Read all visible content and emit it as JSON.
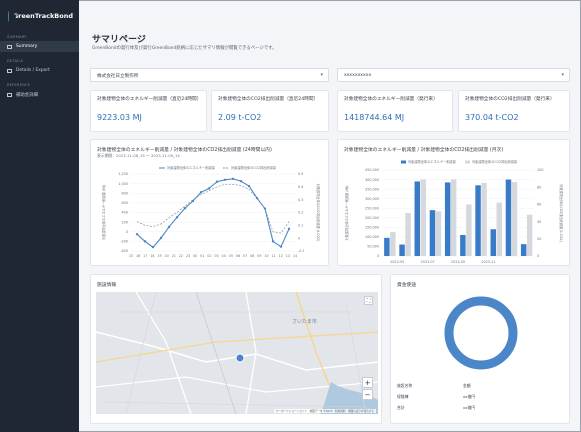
{
  "app": {
    "logo_text": "GreenTrackBond"
  },
  "sidebar": {
    "sections": [
      {
        "label": "SUMMARY",
        "items": [
          {
            "label": "Summary",
            "active": true
          }
        ]
      },
      {
        "label": "DETAILS",
        "items": [
          {
            "label": "Details / Export",
            "active": false
          }
        ]
      },
      {
        "label": "REFERENCE",
        "items": [
          {
            "label": "補助金詳細",
            "active": false
          }
        ]
      }
    ]
  },
  "page": {
    "title": "サマリページ",
    "description": "GreenBondの発行体及び発行GreenBond銘柄に応じたサマリ情報が閲覧できるページです。"
  },
  "filters": {
    "company": {
      "value": "株式会社日立製作所"
    },
    "bond": {
      "value": "xxxxxxxxxx"
    }
  },
  "kpis": [
    {
      "label": "対象建物全体のエネルギー削減量（直近24時間）",
      "value": "9223.03 MJ"
    },
    {
      "label": "対象建物全体のCO2排出削減量（直近24時間）",
      "value": "2.09 t-CO2"
    },
    {
      "label": "対象建物全体のエネルギー削減量（発行来）",
      "value": "1418744.64 MJ"
    },
    {
      "label": "対象建物全体のCO2排出削減量（発行来）",
      "value": "370.04 t-CO2"
    }
  ],
  "chart_24h": {
    "title": "対象建物全体のエネルギー削減量 / 対象建物全体のCO2排出削減量 (24時間以内)",
    "subtitle": "表示期間：2023-11-08_15 〜 2023-11-09_14"
  },
  "chart_monthly": {
    "title": "対象建物全体のエネルギー削減量 / 対象建物全体のCO2排出削減量 (月次)"
  },
  "map_card": {
    "title": "施設情報",
    "labels": {
      "city": "さいたま市",
      "zoom_in": "+",
      "zoom_out": "−",
      "fullscreen": "⛶"
    },
    "attribution": "キーボードショートカット　地図データ ©2023　利用規約　地図の誤りを報告する"
  },
  "fund_card": {
    "title": "資金使途",
    "header": {
      "name": "施設名称",
      "amount": "金額"
    },
    "rows": [
      {
        "name": "保険棟",
        "amount": "xx億円"
      },
      {
        "name": "合計",
        "amount": "xx億円"
      }
    ],
    "ring_color": "#4a86c8"
  },
  "chart_data": [
    {
      "type": "line",
      "series": [
        {
          "name": "対象建物全体のエネルギー削減量",
          "axis": "left",
          "color": "#4a86c8",
          "values": [
            -50,
            -200,
            -320,
            -130,
            100,
            300,
            490,
            640,
            820,
            900,
            1040,
            1080,
            1100,
            1050,
            950,
            700,
            480,
            -200,
            -310,
            60
          ]
        },
        {
          "name": "対象建物全体のCO2排出削減量",
          "axis": "right",
          "color": "#8a9199",
          "dashed": true,
          "values": [
            0.13,
            0.1,
            0.09,
            0.11,
            0.16,
            0.2,
            0.25,
            0.3,
            0.34,
            0.37,
            0.4,
            0.42,
            0.42,
            0.41,
            0.38,
            0.31,
            0.23,
            0.05,
            0.04,
            0.13
          ]
        }
      ],
      "x": [
        "15",
        "16",
        "17",
        "18",
        "19",
        "20",
        "21",
        "22",
        "23",
        "00",
        "01",
        "02",
        "03",
        "04",
        "05",
        "06",
        "07",
        "08",
        "09",
        "10",
        "11",
        "12",
        "13",
        "14"
      ],
      "ylim": [
        -400,
        1200
      ],
      "y2lim": [
        -0.1,
        0.5
      ],
      "yticks": [
        "1,200",
        "1,000",
        "800",
        "600",
        "400",
        "200",
        "0",
        "-200",
        "-400"
      ],
      "y2ticks": [
        "0.5",
        "0.4",
        "0.3",
        "0.2",
        "0.1",
        "0",
        "-0.1"
      ],
      "ylabel": "対象建物全体のエネルギー削減量 (MJ)",
      "y2label": "対象建物全体のCO2排出削減量 (t-CO2)",
      "legend": "top"
    },
    {
      "type": "bar",
      "categories": [
        "2023-05",
        "2023-07",
        "2023-09",
        "2023-11"
      ],
      "x_points": 10,
      "series": [
        {
          "name": "対象建物全体のエネルギー削減量",
          "color": "#3a7bc8",
          "values": [
            95000,
            60000,
            390000,
            240000,
            385000,
            110000,
            370000,
            140000,
            400000,
            62000
          ]
        },
        {
          "name": "対象建物全体のCO2排出削減量",
          "color": "#d5d9de",
          "values": [
            28,
            50,
            89,
            52,
            89,
            60,
            85,
            62,
            86,
            48
          ]
        }
      ],
      "ylim": [
        0,
        450000
      ],
      "y2lim": [
        0,
        100
      ],
      "yticks": [
        "450,000",
        "400,000",
        "350,000",
        "300,000",
        "250,000",
        "200,000",
        "150,000",
        "100,000",
        "50,000",
        "0"
      ],
      "y2ticks": [
        "100",
        "80",
        "60",
        "40",
        "20",
        "0"
      ],
      "ylabel": "対象建物全体のエネルギー削減量 (MJ)",
      "y2label": "対象建物全体のCO2排出削減量 (t-CO2)",
      "legend": "top"
    }
  ]
}
